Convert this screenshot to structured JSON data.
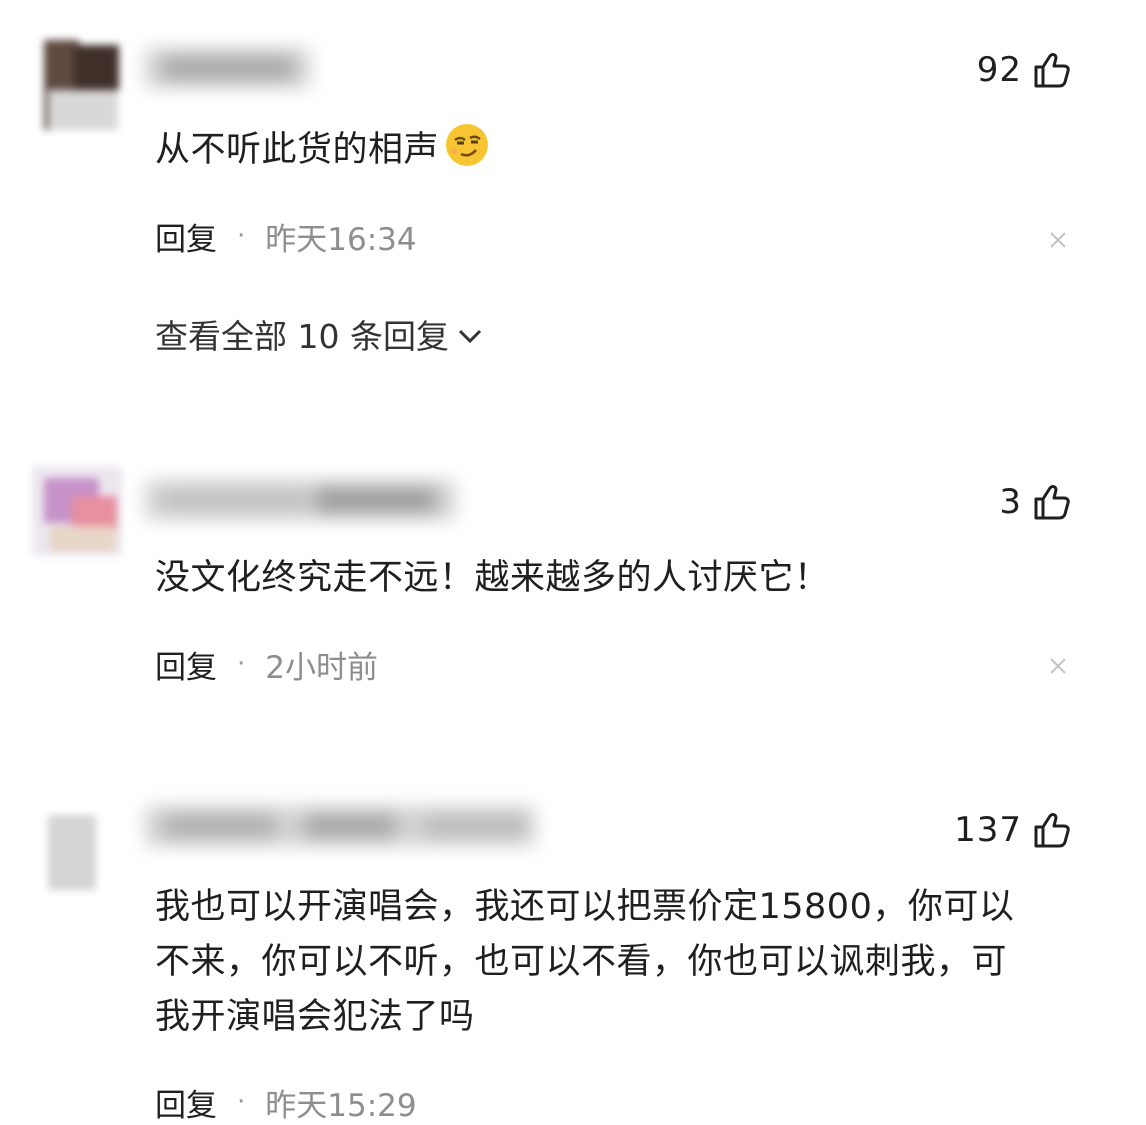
{
  "comments": [
    {
      "likes": "92",
      "text": "从不听此货的相声",
      "emoji": "smirk-emoji",
      "reply_label": "回复",
      "separator": "·",
      "time": "昨天16:34",
      "view_all": "查看全部 10 条回复"
    },
    {
      "likes": "3",
      "text": "没文化终究走不远！越来越多的人讨厌它！",
      "reply_label": "回复",
      "separator": "·",
      "time": "2小时前"
    },
    {
      "likes": "137",
      "text_lines": [
        "我也可以开演唱会，我还可以把票价定15800，你可以",
        "不来，你可以不听，也可以不看，你也可以讽刺我，可",
        "我开演唱会犯法了吗"
      ],
      "reply_label": "回复",
      "separator": "·",
      "time": "昨天15:29"
    }
  ],
  "icons": {
    "like": "thumbs-up-icon",
    "close": "close-icon",
    "expand": "chevron-down-icon"
  }
}
